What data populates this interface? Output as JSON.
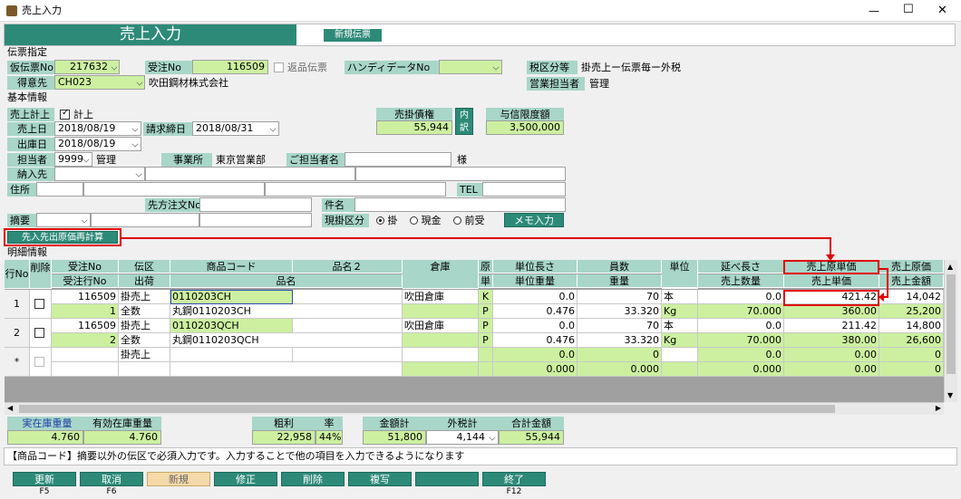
{
  "window": {
    "title": "売上入力",
    "minimize": "—",
    "maximize": "☐",
    "close": "✕"
  },
  "banner": {
    "title": "売上入力",
    "mode": "新規伝票"
  },
  "sec1": "伝票指定",
  "slip": {
    "denpyo_label": "仮伝票No",
    "denpyo_value": "217632",
    "juchu_label": "受注No",
    "juchu_value": "116509",
    "henpin_label": "返品伝票",
    "handy_label": "ハンディデータNo",
    "handy_value": "",
    "zei_label": "税区分等",
    "zei_value": "掛売上ー伝票毎ー外税",
    "tokui_label": "得意先",
    "tokui_code": "CH023",
    "tokui_name": "吹田鋼材株式会社",
    "eigyo_label": "営業担当者",
    "eigyo_value": "管理"
  },
  "sec2": "基本情報",
  "basic": {
    "keijo_label": "売上計上",
    "keijo_check": "計上",
    "uriagebi_label": "売上日",
    "uriagebi": "2018/08/19",
    "seikyu_label": "請求締日",
    "seikyu": "2018/08/31",
    "shukko_label": "出庫日",
    "shukko": "2018/08/19",
    "tanto_label": "担当者",
    "tanto_code": "9999",
    "tanto_name": "管理",
    "jigyo_label": "事業所",
    "jigyo_value": "東京営業部",
    "gotanto_label": "ご担当者名",
    "sama": "様",
    "nonyu_label": "納入先",
    "jusho_label": "住所",
    "tel_label": "TEL",
    "sakichu_label": "先方注文No",
    "kenmei_label": "件名",
    "tekiyo_label": "摘要",
    "genkake_label": "現掛区分",
    "radio": [
      "掛",
      "現金",
      "前受"
    ],
    "memo_btn": "メモ入力",
    "urikake_label": "売掛債権",
    "urikake_value": "55,944",
    "uchi": "内訳",
    "yoshin_label": "与信限度額",
    "yoshin_value": "3,500,000",
    "recalc_btn": "先入先出原価再計算"
  },
  "sec3": "明細情報",
  "grid": {
    "h_rowno": "行No",
    "h_sakujo": "削除",
    "h_juchu": "受注No",
    "h_juchugyo": "受注行No",
    "h_denku": "伝区",
    "h_shukka": "出荷",
    "h_code": "商品コード",
    "h_hinmei": "品名",
    "h_hinmei2": "品名２",
    "h_soko": "倉庫",
    "h_gen": "原",
    "h_tan": "単",
    "h_tancho": "単位長さ",
    "h_tanju": "単位重量",
    "h_suin": "員数",
    "h_juryo": "重量",
    "h_tani": "単位",
    "h_nobe": "延べ長さ",
    "h_urisu": "売上数量",
    "h_genka": "売上原単価",
    "h_tanka": "売上単価",
    "h_genkagaku": "売上原価",
    "h_kingaku": "売上金額",
    "rows": [
      {
        "no": "1",
        "juchu": "116509",
        "gyo": "1",
        "denku": "掛売上",
        "shukka": "全数",
        "code": "0110203CH",
        "hinmei": "丸鋼0110203CH",
        "soko": "吹田倉庫",
        "gen": "K",
        "tan": "P",
        "tancho": "0.0",
        "tanju": "0.476",
        "suin": "70",
        "juryo": "33.320",
        "tani1": "本",
        "tani2": "Kg",
        "nobe": "0.0",
        "urisu": "70.000",
        "genka": "421.42",
        "tanka": "360.00",
        "genkagaku": "14,042",
        "kingaku": "25,200"
      },
      {
        "no": "2",
        "juchu": "116509",
        "gyo": "2",
        "denku": "掛売上",
        "shukka": "全数",
        "code": "0110203QCH",
        "hinmei": "丸鋼0110203QCH",
        "soko": "吹田倉庫",
        "gen": "P",
        "tan": "P",
        "tancho": "0.0",
        "tanju": "0.476",
        "suin": "70",
        "juryo": "33.320",
        "tani1": "本",
        "tani2": "Kg",
        "nobe": "0.0",
        "urisu": "70.000",
        "genka": "211.42",
        "tanka": "380.00",
        "genkagaku": "14,800",
        "kingaku": "26,600"
      },
      {
        "no": "*",
        "juchu": "",
        "gyo": "",
        "denku": "掛売上",
        "shukka": "",
        "code": "",
        "hinmei": "",
        "soko": "",
        "gen": "",
        "tan": "",
        "tancho": "0.0",
        "tanju": "0.000",
        "suin": "0",
        "juryo": "0.000",
        "tani1": "",
        "tani2": "",
        "nobe": "0.0",
        "urisu": "0.000",
        "genka": "0.00",
        "tanka": "0.00",
        "genkagaku": "0",
        "kingaku": "0"
      }
    ]
  },
  "totals": {
    "jitsu_label": "実在庫重量",
    "jitsu_value": "4.760",
    "yuko_label": "有効在庫重量",
    "yuko_value": "4.760",
    "arari_label": "粗利",
    "arari_value": "22,958",
    "ritsu_label": "率",
    "ritsu_value": "44%",
    "kingaku_label": "金額計",
    "kingaku_value": "51,800",
    "gaizei_label": "外税計",
    "gaizei_value": "4,144",
    "gokei_label": "合計金額",
    "gokei_value": "55,944"
  },
  "status": "【商品コード】摘要以外の伝区で必須入力です。入力することで他の項目を入力できるようになります",
  "footer": [
    {
      "label": "更新",
      "key": "F5"
    },
    {
      "label": "取消",
      "key": "F6"
    },
    {
      "label": "新規",
      "key": ""
    },
    {
      "label": "修正",
      "key": ""
    },
    {
      "label": "削除",
      "key": ""
    },
    {
      "label": "複写",
      "key": ""
    },
    {
      "label": "",
      "key": ""
    },
    {
      "label": "終了",
      "key": "F12"
    }
  ],
  "colors": {
    "accent": "#2d8a78",
    "label_bg": "#a8d6c9",
    "input_yellow": "#ccf0a0",
    "highlight": "#e00000"
  }
}
